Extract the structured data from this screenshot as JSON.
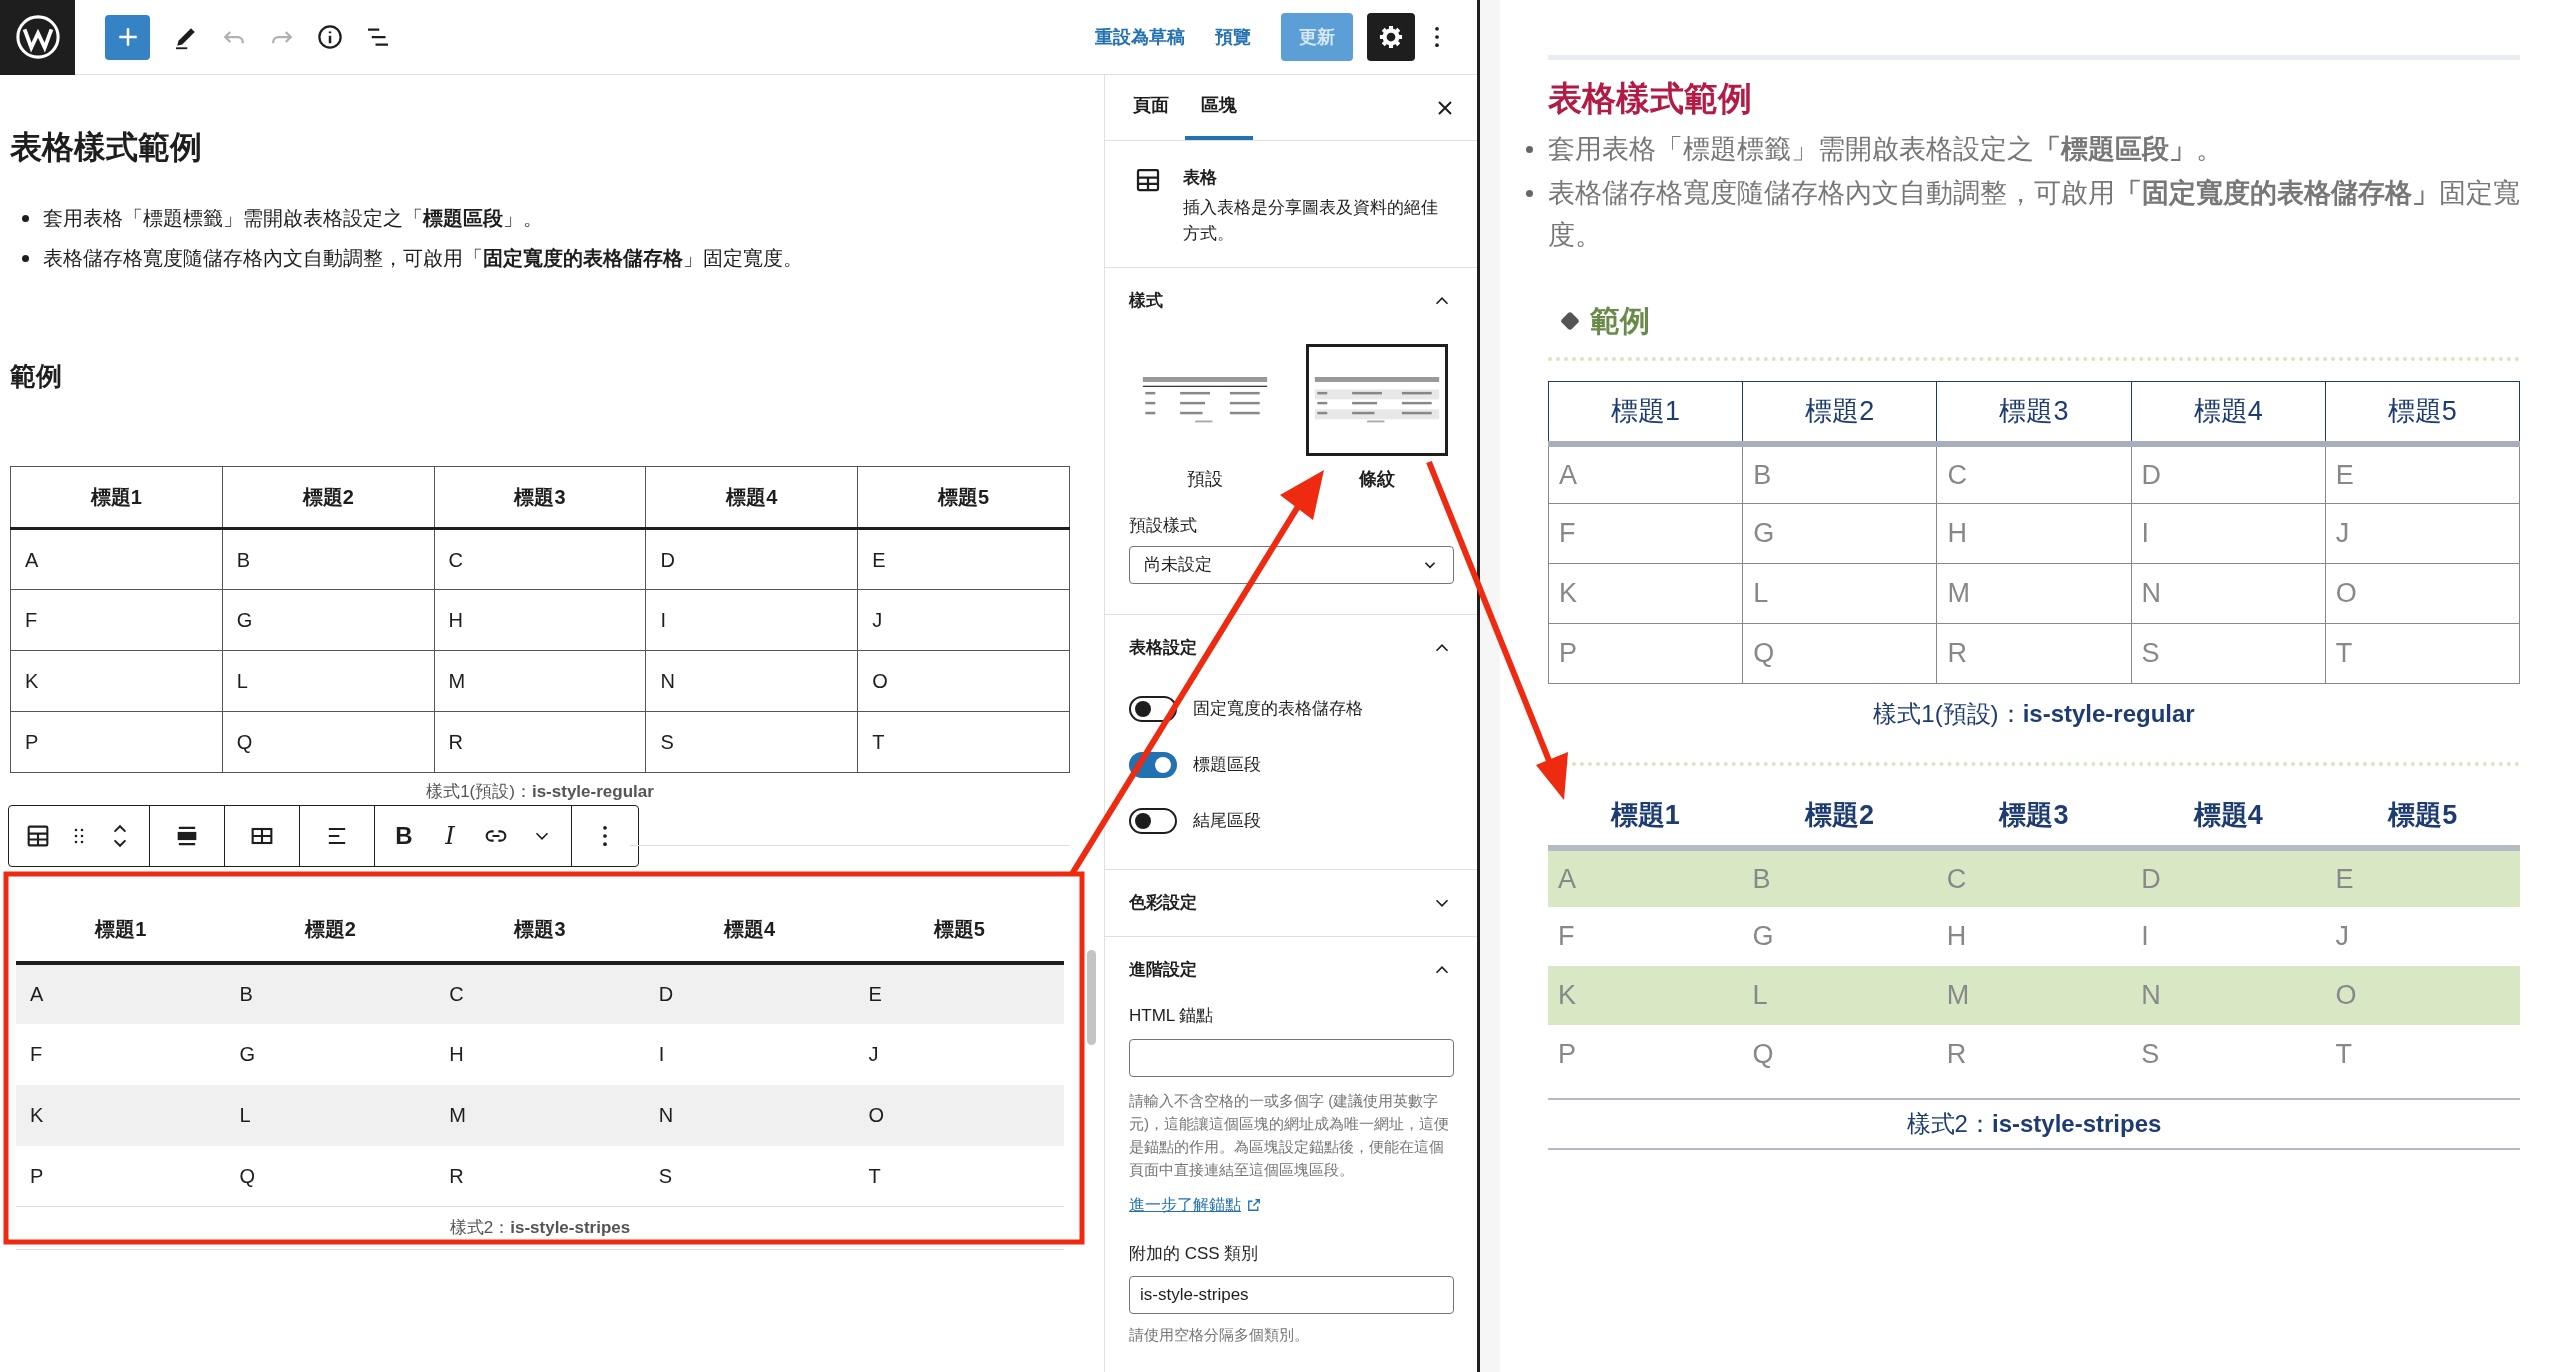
{
  "top_bar": {
    "tools": [
      {
        "kind": "add",
        "disabled": false
      },
      {
        "kind": "edit",
        "disabled": false
      },
      {
        "kind": "undo",
        "disabled": true
      },
      {
        "kind": "redo",
        "disabled": true
      },
      {
        "kind": "info",
        "disabled": false
      },
      {
        "kind": "outline",
        "disabled": false
      }
    ],
    "links": [
      "重設為草稿",
      "預覽"
    ],
    "update": {
      "label": "更新",
      "disabled": true
    },
    "settings_active": true
  },
  "editor": {
    "title": "表格樣式範例",
    "bullets": [
      "套用表格「標題標籤」需開啟表格設定之「**標題區段**」。",
      "表格儲存格寬度隨儲存格內文自動調整，可啟用「**固定寬度的表格儲存格**」固定寬度。"
    ],
    "heading": "範例",
    "tables": [
      {
        "kind": "regular",
        "columns": [
          "標題1",
          "標題2",
          "標題3",
          "標題4",
          "標題5"
        ],
        "rows": [
          [
            "A",
            "B",
            "C",
            "D",
            "E"
          ],
          [
            "F",
            "G",
            "H",
            "I",
            "J"
          ],
          [
            "K",
            "L",
            "M",
            "N",
            "O"
          ],
          [
            "P",
            "Q",
            "R",
            "S",
            "T"
          ]
        ],
        "caption": "樣式1(預設)：**is-style-regular**"
      },
      {
        "kind": "stripes",
        "columns": [
          "標題1",
          "標題2",
          "標題3",
          "標題4",
          "標題5"
        ],
        "rows": [
          [
            "A",
            "B",
            "C",
            "D",
            "E"
          ],
          [
            "F",
            "G",
            "H",
            "I",
            "J"
          ],
          [
            "K",
            "L",
            "M",
            "N",
            "O"
          ],
          [
            "P",
            "Q",
            "R",
            "S",
            "T"
          ]
        ],
        "caption": "樣式2：**is-style-stripes**"
      }
    ],
    "block_toolbar": {
      "format": [
        "B",
        "I"
      ]
    }
  },
  "sidebar": {
    "tabs": [
      {
        "label": "頁面",
        "selected": false
      },
      {
        "label": "區塊",
        "selected": true
      }
    ],
    "block": {
      "name": "表格",
      "description": "插入表格是分享圖表及資料的絕佳方式。"
    },
    "styles": {
      "title": "樣式",
      "expanded": true,
      "options": [
        {
          "label": "預設",
          "kind": "regular",
          "selected": false
        },
        {
          "label": "條紋",
          "kind": "stripes",
          "selected": true
        }
      ],
      "default_label": "預設樣式",
      "default_value": "尚未設定"
    },
    "table_settings": {
      "title": "表格設定",
      "expanded": true,
      "toggles": [
        {
          "label": "固定寬度的表格儲存格",
          "on": false
        },
        {
          "label": "標題區段",
          "on": true
        },
        {
          "label": "結尾區段",
          "on": false
        }
      ]
    },
    "color_settings": {
      "title": "色彩設定",
      "expanded": false
    },
    "advanced": {
      "title": "進階設定",
      "expanded": true,
      "anchor_label": "HTML 錨點",
      "anchor_help": "請輸入不含空格的一或多個字 (建議使用英數字元)，這能讓這個區塊的網址成為唯一網址，這便是錨點的作用。為區塊設定錨點後，便能在這個頁面中直接連結至這個區塊區段。",
      "learn_more": "進一步了解錨點",
      "css_label": "附加的 CSS 類別",
      "css_value": "is-style-stripes",
      "css_help": "請使用空格分隔多個類別。"
    }
  },
  "preview": {
    "title": "表格樣式範例",
    "bullets": [
      "套用表格「標題標籤」需開啟表格設定之**「標題區段」**。",
      "表格儲存格寬度隨儲存格內文自動調整，可啟用**「固定寬度的表格儲存格」**固定寬度。"
    ],
    "heading": "範例",
    "tables": [
      {
        "kind": "regular",
        "columns": [
          "標題1",
          "標題2",
          "標題3",
          "標題4",
          "標題5"
        ],
        "rows": [
          [
            "A",
            "B",
            "C",
            "D",
            "E"
          ],
          [
            "F",
            "G",
            "H",
            "I",
            "J"
          ],
          [
            "K",
            "L",
            "M",
            "N",
            "O"
          ],
          [
            "P",
            "Q",
            "R",
            "S",
            "T"
          ]
        ],
        "caption": "樣式1(預設)：**is-style-regular**"
      },
      {
        "kind": "stripes",
        "columns": [
          "標題1",
          "標題2",
          "標題3",
          "標題4",
          "標題5"
        ],
        "rows": [
          [
            "A",
            "B",
            "C",
            "D",
            "E"
          ],
          [
            "F",
            "G",
            "H",
            "I",
            "J"
          ],
          [
            "K",
            "L",
            "M",
            "N",
            "O"
          ],
          [
            "P",
            "Q",
            "R",
            "S",
            "T"
          ]
        ],
        "caption": "樣式2：**is-style-stripes**"
      }
    ]
  }
}
